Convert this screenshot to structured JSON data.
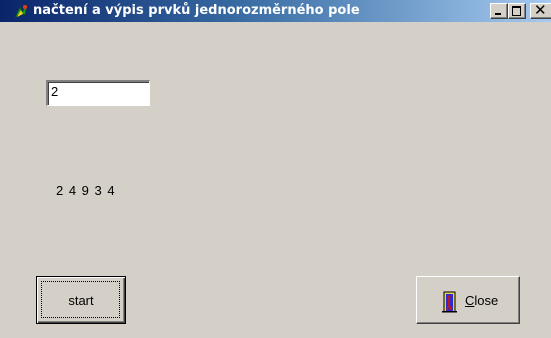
{
  "window": {
    "title": "načtení a výpis prvků jednorozměrného pole",
    "icon": "app-icon",
    "controls": [
      "minimize-icon",
      "maximize-icon",
      "close-icon"
    ]
  },
  "form": {
    "input_value": "2",
    "output_text": "2 4 9 3 4"
  },
  "buttons": {
    "start_label": "start",
    "close_label_accel": "C",
    "close_label_rest": "lose",
    "close_icon": "door-exit-icon"
  }
}
